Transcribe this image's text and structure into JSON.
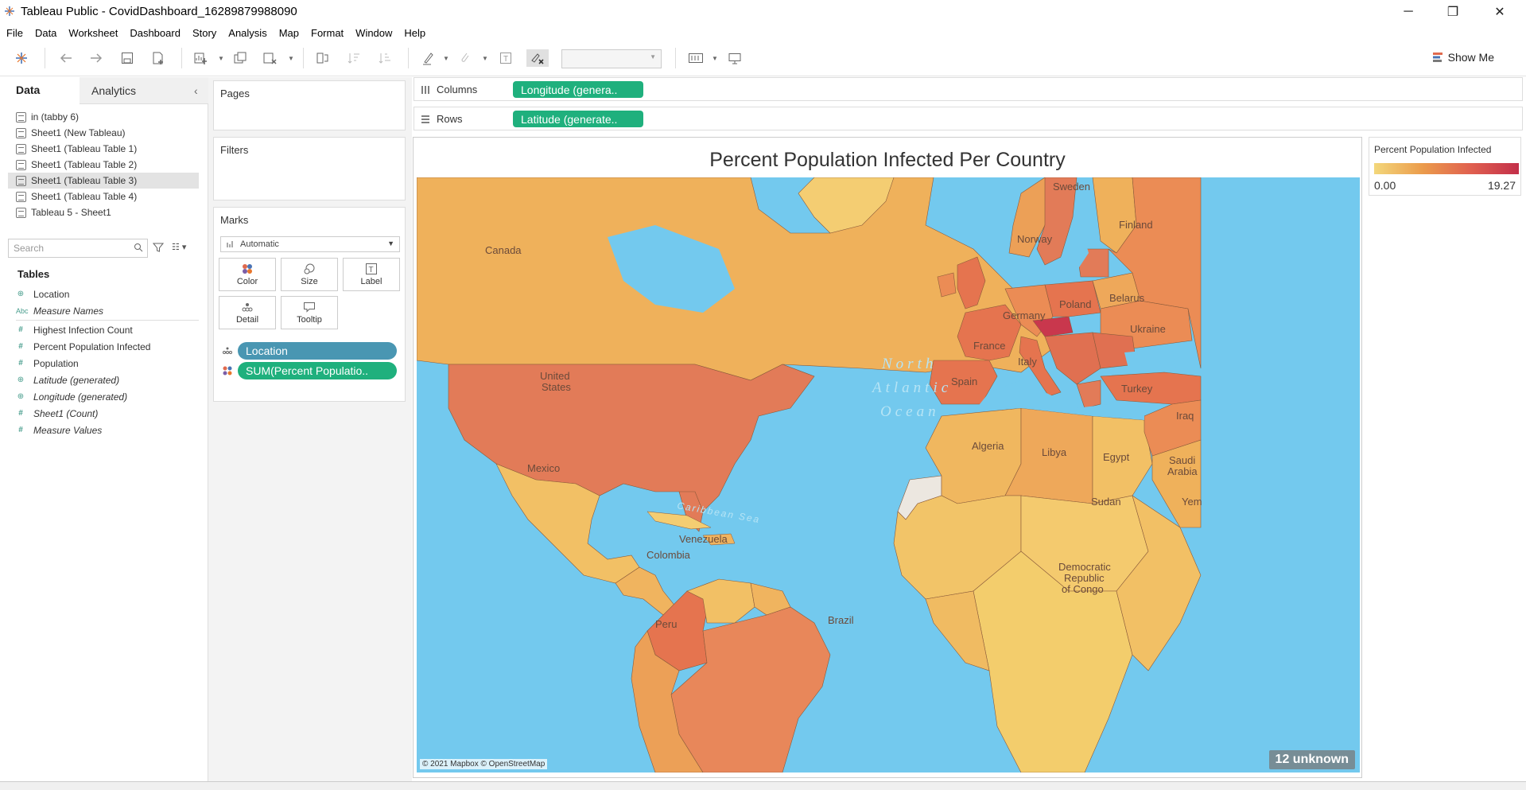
{
  "window": {
    "title": "Tableau Public - CovidDashboard_16289879988090"
  },
  "menu": [
    "File",
    "Data",
    "Worksheet",
    "Dashboard",
    "Story",
    "Analysis",
    "Map",
    "Format",
    "Window",
    "Help"
  ],
  "toolbar": {
    "show_me": "Show Me"
  },
  "left_panel": {
    "tabs": {
      "data": "Data",
      "analytics": "Analytics"
    },
    "data_sources": [
      "in (tabby 6)",
      "Sheet1 (New Tableau)",
      "Sheet1 (Tableau Table 1)",
      "Sheet1 (Tableau Table 2)",
      "Sheet1 (Tableau Table 3)",
      "Sheet1 (Tableau Table 4)",
      "Tableau 5 - Sheet1"
    ],
    "selected_source": "Sheet1 (Tableau Table 3)",
    "search": {
      "placeholder": "Search"
    },
    "tables_heading": "Tables",
    "fields": [
      {
        "label": "Location",
        "icon": "globe-icon"
      },
      {
        "label": "Measure Names",
        "icon": "abc-icon"
      },
      {
        "label": "Highest Infection Count",
        "icon": "hash-icon"
      },
      {
        "label": "Percent Population Infected",
        "icon": "hash-icon"
      },
      {
        "label": "Population",
        "icon": "hash-icon"
      },
      {
        "label": "Latitude (generated)",
        "icon": "globe-icon"
      },
      {
        "label": "Longitude (generated)",
        "icon": "globe-icon"
      },
      {
        "label": "Sheet1 (Count)",
        "icon": "hash-icon"
      },
      {
        "label": "Measure Values",
        "icon": "hash-icon"
      }
    ]
  },
  "cards": {
    "pages": "Pages",
    "filters": "Filters",
    "marks": "Marks",
    "mark_type": "Automatic",
    "mark_buttons": {
      "color": "Color",
      "size": "Size",
      "label": "Label",
      "detail": "Detail",
      "tooltip": "Tooltip"
    },
    "mark_pills": {
      "location": "Location",
      "sum": "SUM(Percent Populatio.."
    }
  },
  "shelves": {
    "columns_label": "Columns",
    "columns_pill": "Longitude (genera..",
    "rows_label": "Rows",
    "rows_pill": "Latitude (generate.."
  },
  "viz": {
    "title": "Percent Population Infected Per Country",
    "attribution": "© 2021 Mapbox © OpenStreetMap",
    "unknown_badge": "12 unknown",
    "labels": {
      "canada": "Canada",
      "us_1": "United",
      "us_2": "States",
      "mexico": "Mexico",
      "colombia": "Colombia",
      "venezuela": "Venezuela",
      "peru": "Peru",
      "brazil": "Brazil",
      "ocean_1": "North",
      "ocean_2": "Atlantic",
      "ocean_3": "Ocean",
      "caribbean": "Caribbean Sea",
      "sweden": "Sweden",
      "finland": "Finland",
      "norway": "Norway",
      "germany": "Germany",
      "poland": "Poland",
      "belarus": "Belarus",
      "ukraine": "Ukraine",
      "france": "France",
      "italy": "Italy",
      "spain": "Spain",
      "turkey": "Turkey",
      "iraq": "Iraq",
      "algeria": "Algeria",
      "libya": "Libya",
      "egypt": "Egypt",
      "saudi_1": "Saudi",
      "saudi_2": "Arabia",
      "sudan": "Sudan",
      "yemen": "Yem",
      "drc_1": "Democratic",
      "drc_2": "Republic",
      "drc_3": "of Congo"
    }
  },
  "legend": {
    "title": "Percent Population Infected",
    "min": "0.00",
    "max": "19.27"
  },
  "colors": {
    "low": "#f3d77b",
    "mid": "#eb9c4c",
    "high": "#e0604f",
    "max": "#c32f4a",
    "water": "#73c9ee",
    "pill_green": "#1fb07d",
    "pill_blue": "#4996b2"
  }
}
